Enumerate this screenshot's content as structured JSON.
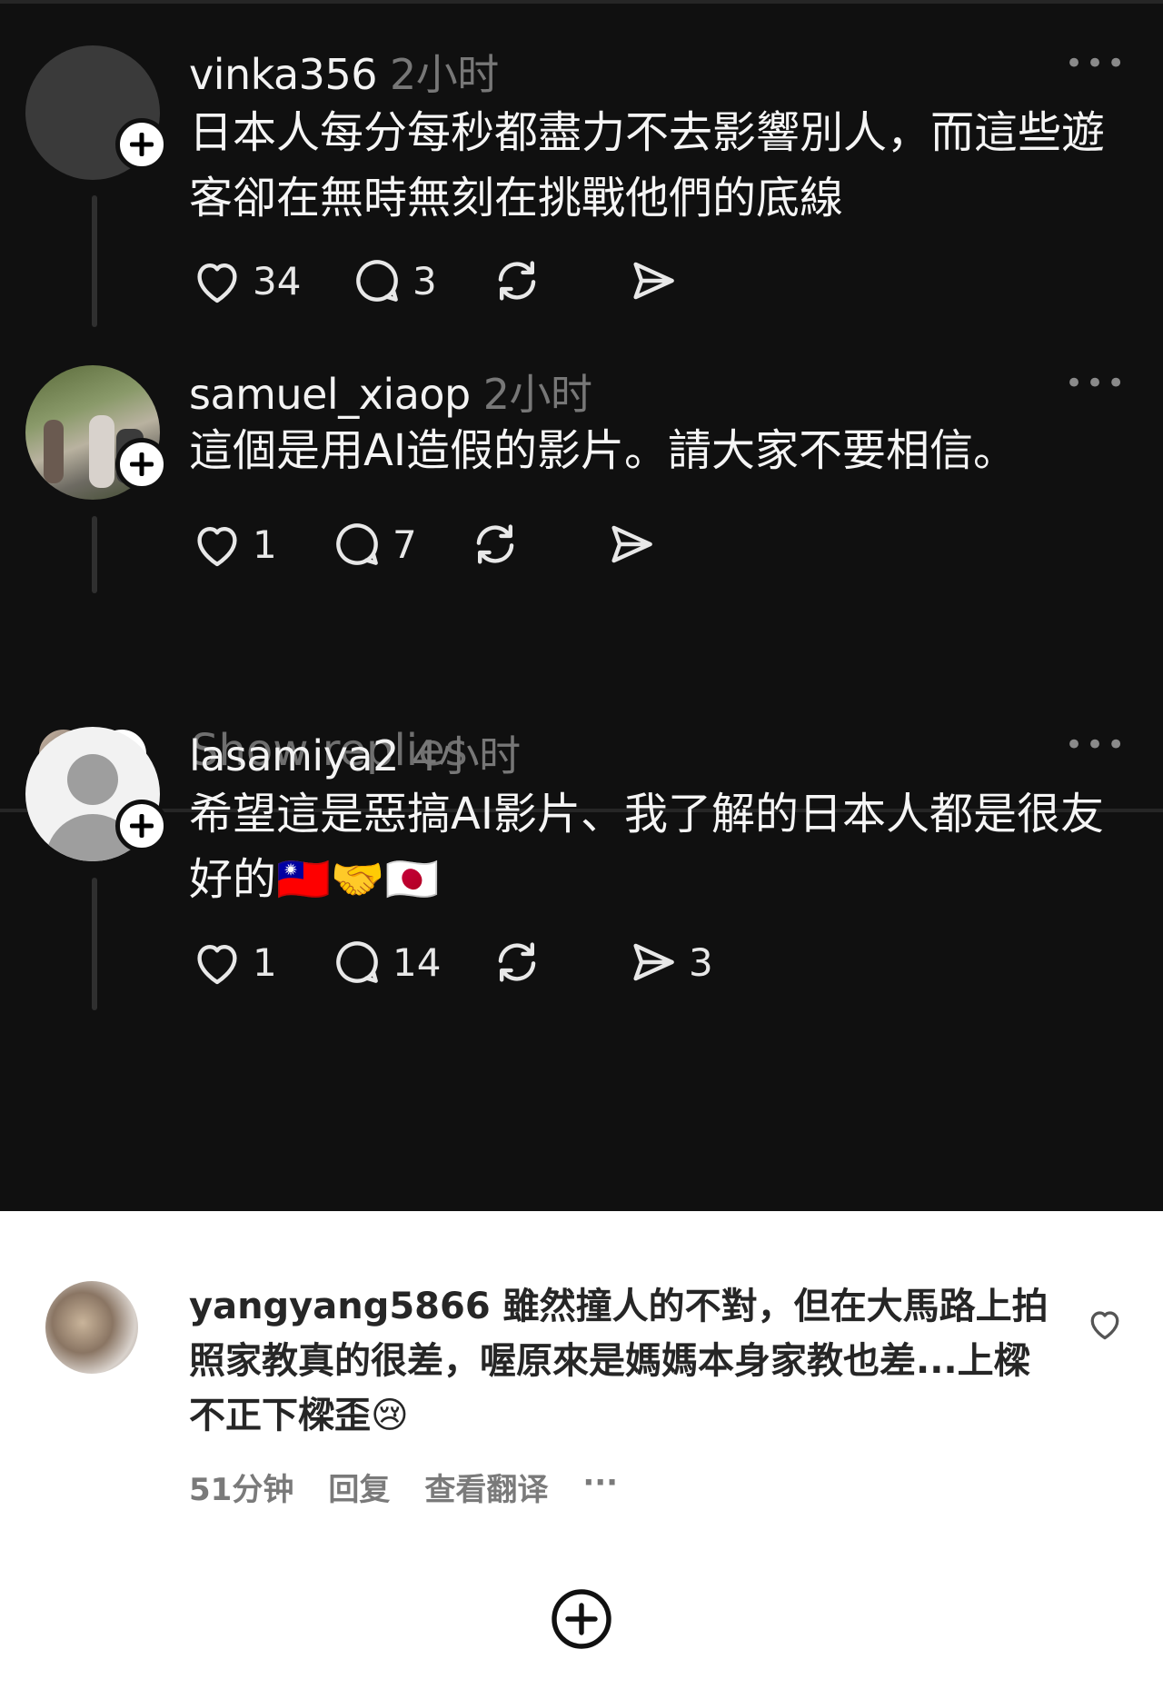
{
  "posts": [
    {
      "username": "vinka356",
      "time": "2小时",
      "text": "日本人每分每秒都盡力不去影響別人，而這些遊客卻在無時無刻在挑戰他們的底線",
      "likes": "34",
      "comments": "3",
      "reposts": "",
      "shares": ""
    },
    {
      "username": "samuel_xiaop",
      "time": "2小时",
      "text": "這個是用AI造假的影片。請大家不要相信。",
      "likes": "1",
      "comments": "7",
      "reposts": "",
      "shares": ""
    },
    {
      "username": "lasamiya2",
      "time": "4小时",
      "text": "希望這是惡搞AI影片、我了解的日本人都是很友好的🇹🇼🤝🇯🇵",
      "likes": "1",
      "comments": "14",
      "reposts": "",
      "shares": "3"
    }
  ],
  "show_replies": "Show replies",
  "instagram_comment": {
    "username": "yangyang5866",
    "text": " 雖然撞人的不對，但在大馬路上拍照家教真的很差，喔原來是媽媽本身家教也差...上樑不正下樑歪😢",
    "time": "51分钟",
    "reply": "回复",
    "translate": "查看翻译",
    "more": "···"
  },
  "icons": {
    "heart": "heart-icon",
    "comment": "comment-icon",
    "repost": "repost-icon",
    "share": "share-icon",
    "follow": "plus-icon",
    "more": "more-icon",
    "expand": "arrow-down-icon"
  },
  "colors": {
    "dark_bg": "#101010",
    "text": "#f5f5f5",
    "muted": "#777777"
  }
}
